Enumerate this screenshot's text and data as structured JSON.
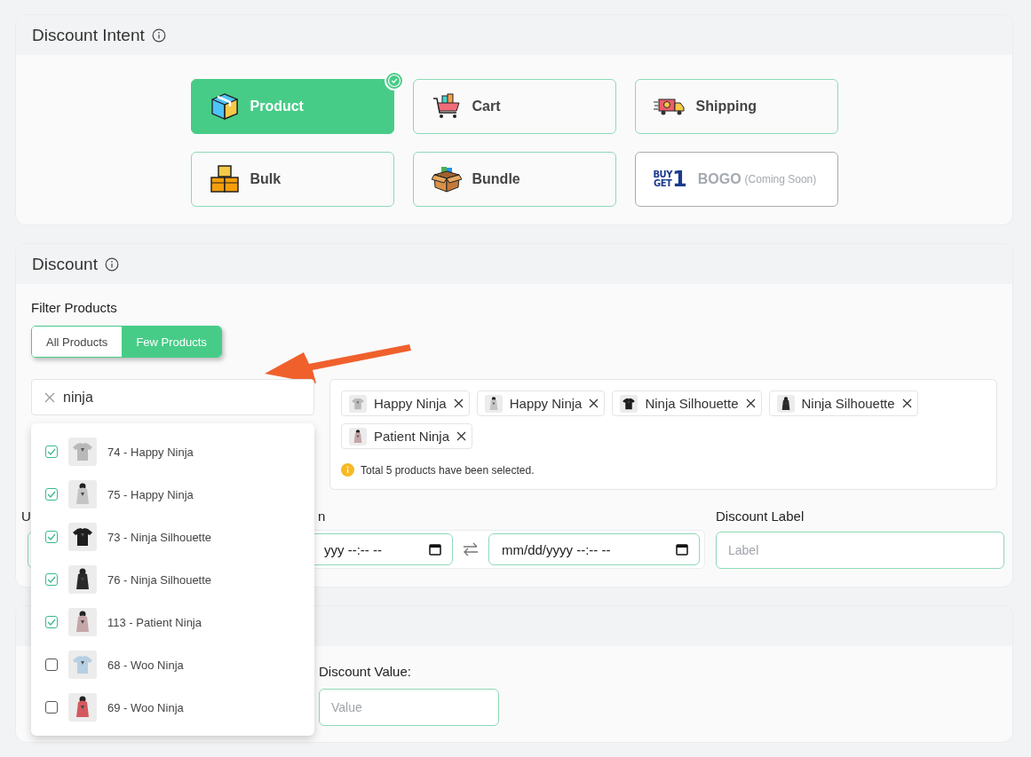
{
  "intent": {
    "title": "Discount Intent",
    "options": [
      {
        "kind": "product",
        "label": "Product",
        "selected": true,
        "disabled": false
      },
      {
        "kind": "cart",
        "label": "Cart",
        "selected": false,
        "disabled": false
      },
      {
        "kind": "shipping",
        "label": "Shipping",
        "selected": false,
        "disabled": false
      },
      {
        "kind": "bulk",
        "label": "Bulk",
        "selected": false,
        "disabled": false
      },
      {
        "kind": "bundle",
        "label": "Bundle",
        "selected": false,
        "disabled": false
      },
      {
        "kind": "bogo",
        "label": "BOGO",
        "note": "(Coming Soon)",
        "selected": false,
        "disabled": true,
        "logo": {
          "lines": [
            "BUY",
            "GET"
          ],
          "digit": "1"
        }
      }
    ]
  },
  "discount": {
    "title": "Discount",
    "filter_label": "Filter Products",
    "filter_options": [
      {
        "label": "All Products",
        "selected": false
      },
      {
        "label": "Few Products",
        "selected": true
      }
    ],
    "search": {
      "value": "ninja"
    },
    "results": [
      {
        "label": "74 - Happy Ninja",
        "checked": true
      },
      {
        "label": "75 - Happy Ninja",
        "checked": true
      },
      {
        "label": "73 - Ninja Silhouette",
        "checked": true
      },
      {
        "label": "76 - Ninja Silhouette",
        "checked": true
      },
      {
        "label": "113 - Patient Ninja",
        "checked": true
      },
      {
        "label": "68 - Woo Ninja",
        "checked": false
      },
      {
        "label": "69 - Woo Ninja",
        "checked": false
      }
    ],
    "selected_tags": [
      "Happy Ninja",
      "Happy Ninja",
      "Ninja Silhouette",
      "Ninja Silhouette",
      "Patient Ninja"
    ],
    "selection_note": "Total 5 products have been selected.",
    "label_1": "U",
    "label_2": "n",
    "date_start": "yyy --:-- --",
    "date_end": "mm/dd/yyyy --:-- --",
    "discount_label": {
      "label": "Discount Label",
      "placeholder": "Label"
    }
  },
  "value_section": {
    "value_label": "Discount Value:",
    "value_placeholder": "Value"
  }
}
